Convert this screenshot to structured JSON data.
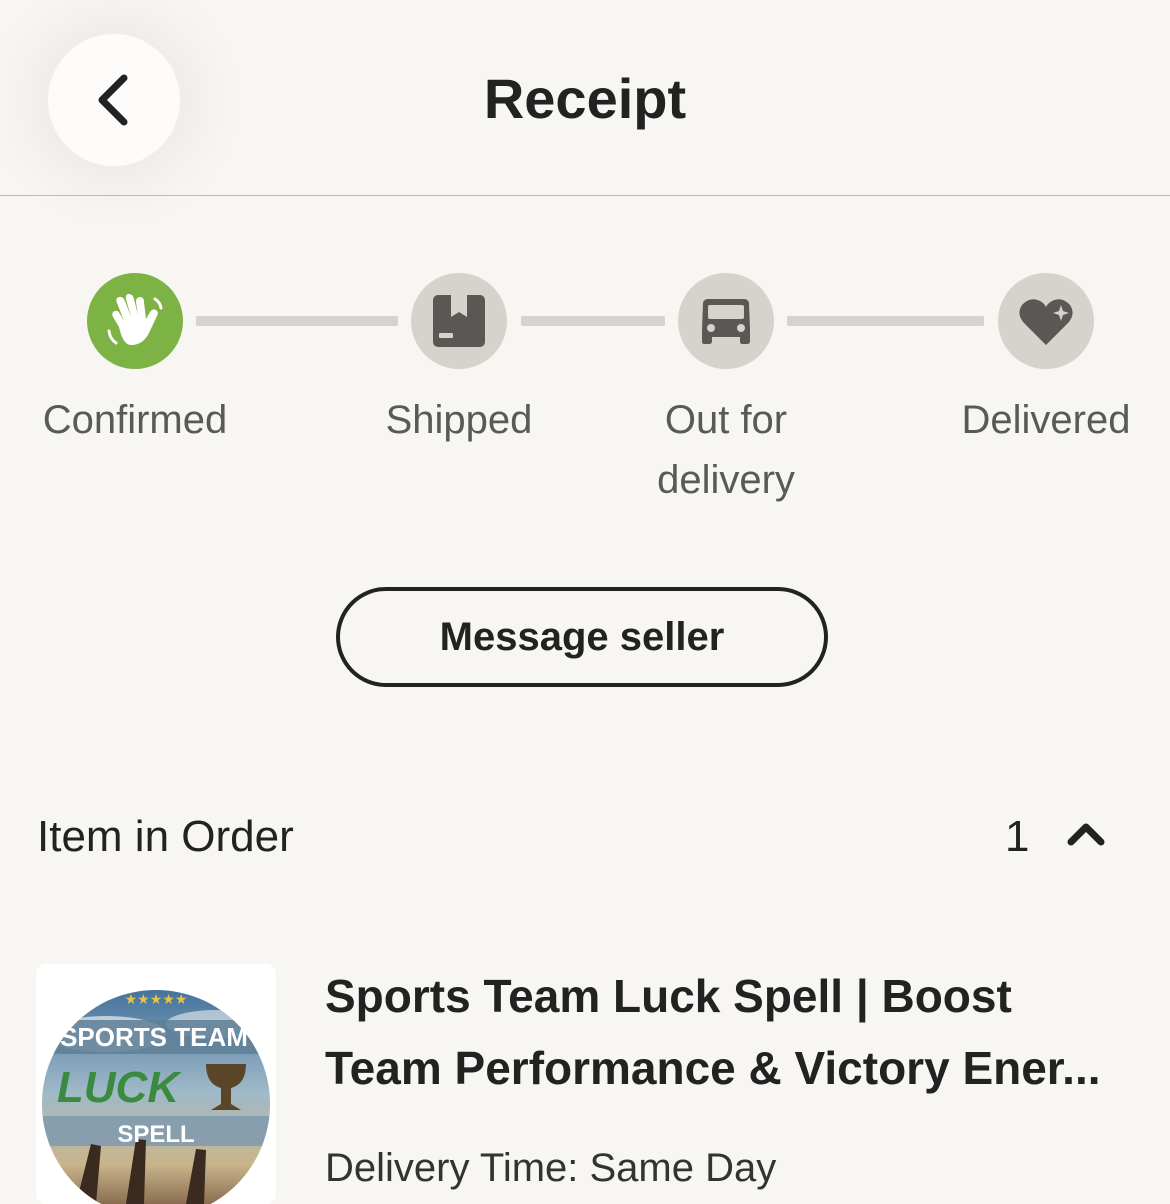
{
  "header": {
    "title": "Receipt",
    "back_icon": "chevron-left-icon"
  },
  "progress": {
    "steps": [
      {
        "label_line1": "Confirmed",
        "label_line2": "",
        "icon": "waving-hand-icon",
        "status": "complete"
      },
      {
        "label_line1": "Shipped",
        "label_line2": "",
        "icon": "package-icon",
        "status": "pending"
      },
      {
        "label_line1": "Out for",
        "label_line2": "delivery",
        "icon": "truck-icon",
        "status": "pending"
      },
      {
        "label_line1": "Delivered",
        "label_line2": "",
        "icon": "heart-sparkle-icon",
        "status": "pending"
      }
    ],
    "colors": {
      "complete": "#7db244",
      "pending": "#d6d2cc",
      "icon_pending": "#5a5755"
    }
  },
  "actions": {
    "message_seller_label": "Message seller"
  },
  "order": {
    "section_title": "Item in Order",
    "item_count": "1",
    "collapse_icon": "chevron-up-icon",
    "items": [
      {
        "title": "Sports Team Luck Spell | Boost Team Performance & Victory Ener...",
        "delivery_time": "Delivery Time: Same Day",
        "thumbnail": {
          "line1": "SPORTS TEAM",
          "line2": "LUCK",
          "line3": "SPELL"
        }
      }
    ]
  }
}
